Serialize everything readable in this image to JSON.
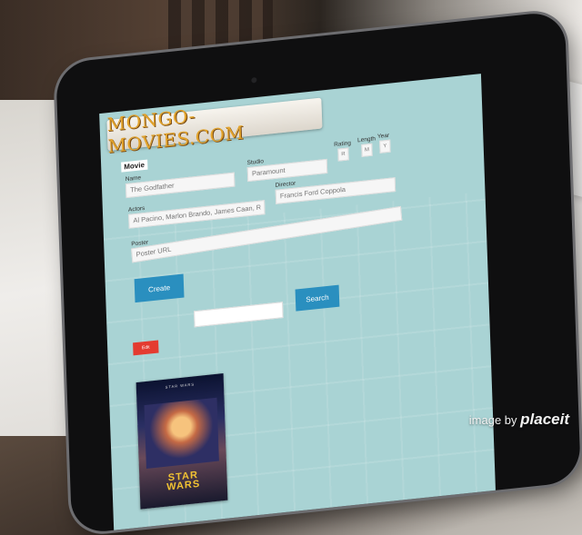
{
  "site": {
    "logo_text": "MONGO-MOVIES.COM"
  },
  "form": {
    "section_label": "Movie",
    "name": {
      "label": "Name",
      "placeholder": "The Godfather"
    },
    "studio": {
      "label": "Studio",
      "placeholder": "Paramount"
    },
    "rating": {
      "label": "Rating",
      "placeholder": "R"
    },
    "length": {
      "label": "Length",
      "placeholder": "M"
    },
    "year": {
      "label": "Year",
      "placeholder": "Y"
    },
    "actors": {
      "label": "Actors",
      "placeholder": "Al Pacino, Marlon Brando, James Caan, Robert Du"
    },
    "director": {
      "label": "Director",
      "placeholder": "Francis Ford Coppola"
    },
    "poster": {
      "label": "Poster",
      "placeholder": "Poster URL"
    },
    "create_label": "Create"
  },
  "search": {
    "placeholder": "",
    "button_label": "Search"
  },
  "list": {
    "edit_label": "Edit"
  },
  "poster_item": {
    "top_text": "STAR WARS",
    "title_text": "STAR WARS"
  },
  "watermark": {
    "prefix": "image by",
    "brand": "placeit"
  }
}
